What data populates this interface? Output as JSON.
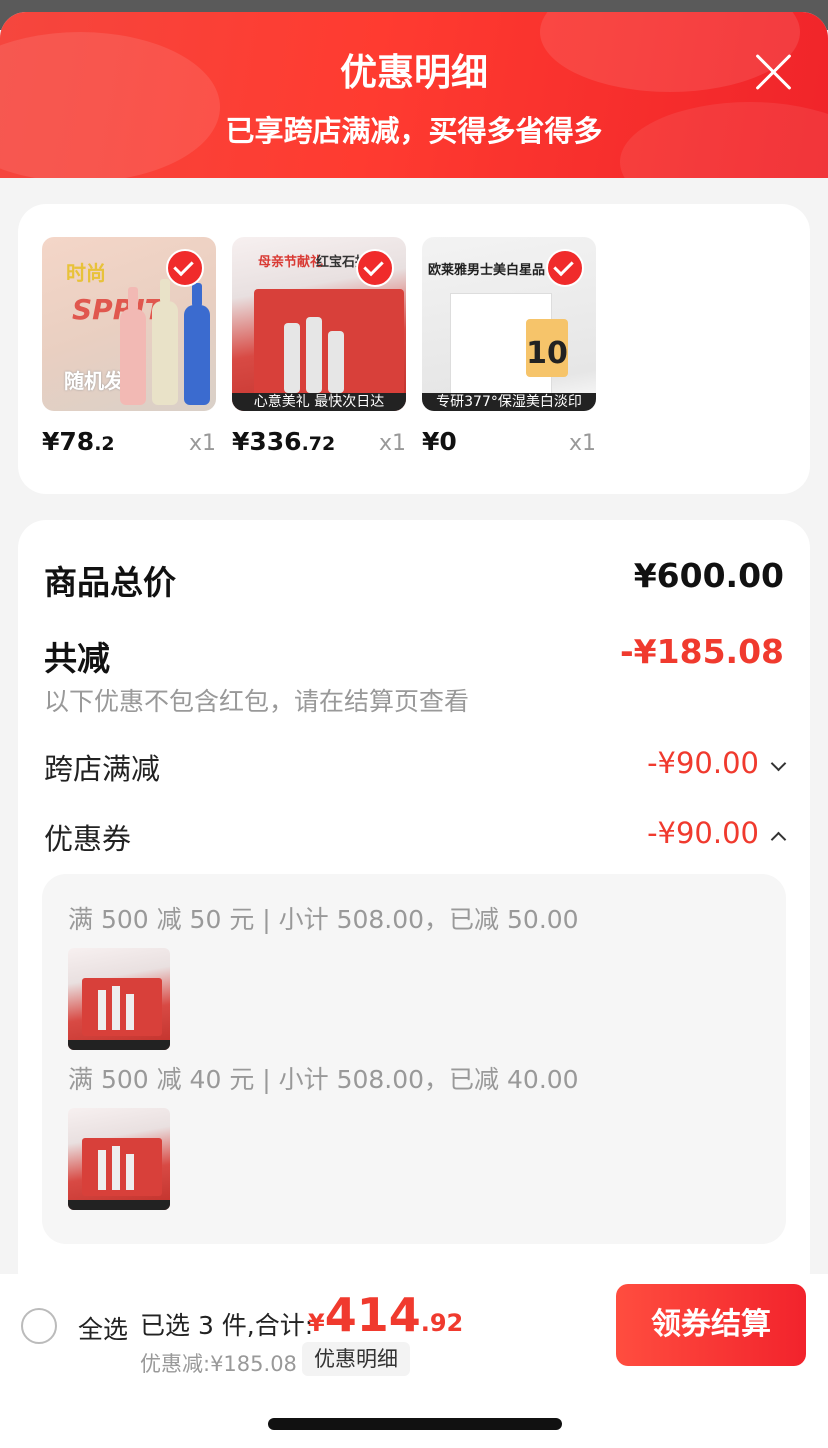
{
  "header": {
    "title": "优惠明细",
    "subtitle": "已享跨店满减，买得多省得多"
  },
  "products": [
    {
      "price_int": "¥78",
      "price_dec": ".2",
      "qty": "x1",
      "art_text_1": "时尚",
      "art_text_2": "SPRIT",
      "art_text_3": "随机发"
    },
    {
      "price_int": "¥336",
      "price_dec": ".72",
      "qty": "x1",
      "art_text_1": "母亲节献礼",
      "art_text_2": "红宝石抗皱",
      "art_text_3": "心意美礼 最快次日达"
    },
    {
      "price_int": "¥0",
      "price_dec": "",
      "qty": "x1",
      "art_text_1": "欧莱雅男士美白星品",
      "art_text_2": "10",
      "art_text_3": "专研377°保湿美白淡印"
    }
  ],
  "summary": {
    "total_label": "商品总价",
    "total_value": "¥600.00",
    "reduce_label": "共减",
    "reduce_value": "-¥185.08",
    "note": "以下优惠不包含红包，请在结算页查看",
    "cross_store_label": "跨店满减",
    "cross_store_value": "-¥90.00",
    "coupon_label": "优惠券",
    "coupon_value": "-¥90.00"
  },
  "coupons": [
    {
      "text": "满 500 减 50 元 | 小计 508.00，已减 50.00"
    },
    {
      "text": "满 500 减 40 元 | 小计 508.00，已减 40.00"
    }
  ],
  "bottom": {
    "select_all": "全选",
    "selected_text": "已选 3 件,合计:",
    "total_currency": "¥",
    "total_int": "414",
    "total_dec": ".92",
    "discount_text": "优惠减:¥185.08",
    "detail_tag": "优惠明细",
    "checkout": "领券结算"
  },
  "colors": {
    "accent": "#f03a2e",
    "header": "#ff3b30"
  }
}
